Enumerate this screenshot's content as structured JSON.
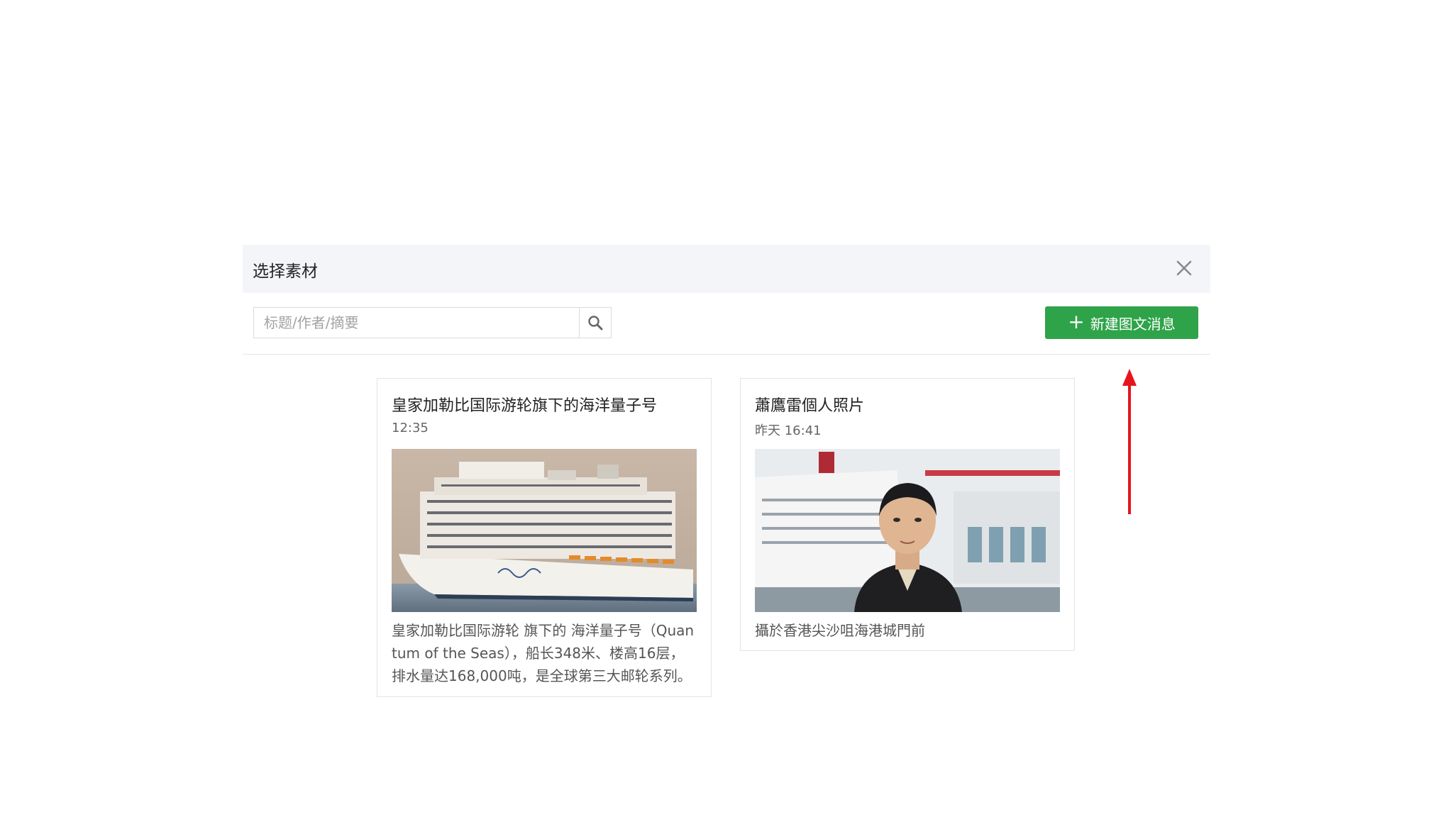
{
  "dialog": {
    "title": "选择素材",
    "close_icon": "close-icon"
  },
  "search": {
    "placeholder": "标题/作者/摘要",
    "value": "",
    "icon": "search-icon"
  },
  "new_button": {
    "label": "新建图文消息",
    "icon": "plus-icon",
    "color": "#2fa34a"
  },
  "cards": [
    {
      "title": "皇家加勒比国际游轮旗下的海洋量子号",
      "time": "12:35",
      "desc_lines": [
        "皇家加勒比国际游轮 旗下的 海洋量子号（Quan",
        "tum of the Seas），船长348米、楼高16层，",
        "排水量达168,000吨，是全球第三大邮轮系列。"
      ],
      "image_name": "cruise-ship-image"
    },
    {
      "title": "蕭鷹雷個人照片",
      "time": "昨天 16:41",
      "desc_lines": [
        "攝於香港尖沙咀海港城門前"
      ],
      "image_name": "person-portrait-image"
    }
  ],
  "colors": {
    "header_bg": "#f4f5f9",
    "accent_green": "#2fa34a",
    "annotation_red": "#e8141b"
  }
}
